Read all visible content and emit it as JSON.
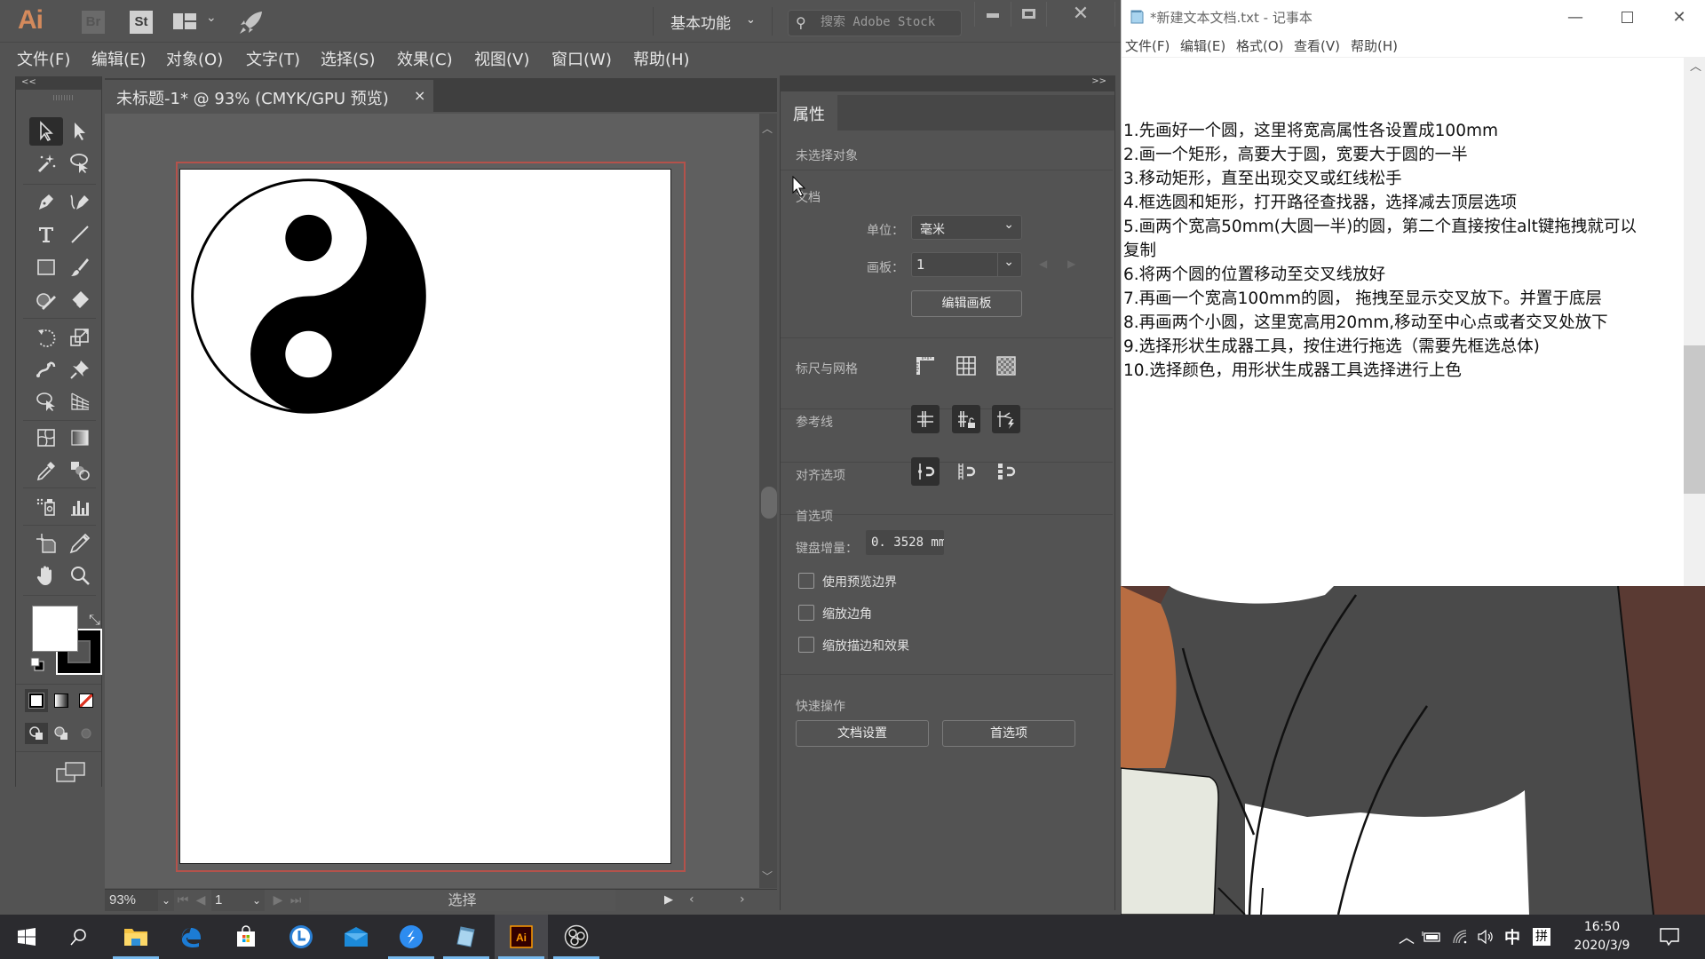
{
  "illustrator": {
    "logo": "Ai",
    "bridge_label": "Br",
    "stock_label": "St",
    "workspace": "基本功能",
    "stock_search_placeholder": "搜索 Adobe Stock",
    "menu": [
      "文件(F)",
      "编辑(E)",
      "对象(O)",
      "文字(T)",
      "选择(S)",
      "效果(C)",
      "视图(V)",
      "窗口(W)",
      "帮助(H)"
    ],
    "collapse_left": "<<",
    "collapse_right": ">>",
    "document_tab": {
      "title": "未标题-1* @ 93% (CMYK/GPU 预览)",
      "close": "×"
    },
    "tools": [
      "selection-tool",
      "direct-selection-tool",
      "magic-wand-tool",
      "lasso-tool",
      "pen-tool",
      "curvature-tool",
      "type-tool",
      "line-segment-tool",
      "rectangle-tool",
      "paintbrush-tool",
      "shaper-tool",
      "eraser-tool",
      "rotate-tool",
      "scale-tool",
      "puppet-warp-tool",
      "pin-tool",
      "free-transform-tool",
      "perspective-grid-tool",
      "mesh-tool",
      "gradient-tool",
      "eyedropper-tool",
      "blend-tool",
      "symbol-sprayer-tool",
      "column-graph-tool",
      "artboard-tool",
      "slice-tool",
      "hand-tool",
      "zoom-tool"
    ],
    "fill_color": "#ffffff",
    "stroke_color": "#000000",
    "status_bar": {
      "zoom": "93%",
      "artboard_number": "1",
      "current_tool": "选择"
    },
    "properties_panel": {
      "tab": "属性",
      "no_selection": "未选择对象",
      "document_section": "文档",
      "units_label": "单位：",
      "units_value": "毫米",
      "artboard_label": "画板：",
      "artboard_value": "1",
      "edit_artboards_button": "编辑画板",
      "rulers_grids_label": "标尺与网格",
      "guides_label": "参考线",
      "snap_options_label": "对齐选项",
      "preferences_label": "首选项",
      "keyboard_increment_label": "键盘增量：",
      "keyboard_increment_value": "0. 3528 mm",
      "checkboxes": [
        {
          "label": "使用预览边界",
          "checked": false
        },
        {
          "label": "缩放边角",
          "checked": false
        },
        {
          "label": "缩放描边和效果",
          "checked": false
        }
      ],
      "quick_actions_label": "快速操作",
      "document_setup_button": "文档设置",
      "preferences_button": "首选项"
    }
  },
  "notepad": {
    "title": "*新建文本文档.txt - 记事本",
    "menu": [
      "文件(F)",
      "编辑(E)",
      "格式(O)",
      "查看(V)",
      "帮助(H)"
    ],
    "lines": [
      "1.先画好一个圆，这里将宽高属性各设置成100mm",
      "2.画一个矩形，高要大于圆，宽要大于圆的一半",
      "3.移动矩形，直至出现交叉或红线松手",
      "4.框选圆和矩形，打开路径查找器，选择减去顶层选项",
      "5.画两个宽高50mm(大圆一半)的圆，第二个直接按住alt键拖拽就可以",
      "复制",
      "6.将两个圆的位置移动至交叉线放好",
      "7.再画一个宽高100mm的圆， 拖拽至显示交叉放下。并置于底层",
      "8.再画两个小圆，这里宽高用20mm,移动至中心点或者交叉处放下",
      "9.选择形状生成器工具，按住进行拖选（需要先框选总体)",
      "10.选择颜色，用形状生成器工具选择进行上色"
    ]
  },
  "taskbar": {
    "apps": [
      "start",
      "search",
      "file-explorer",
      "edge",
      "store",
      "clock-app",
      "mail",
      "feishu-app",
      "notepad",
      "illustrator",
      "obs"
    ],
    "tray": {
      "ime_mode": "中",
      "ime_name": "拼",
      "time": "16:50",
      "date": "2020/3/9"
    }
  }
}
